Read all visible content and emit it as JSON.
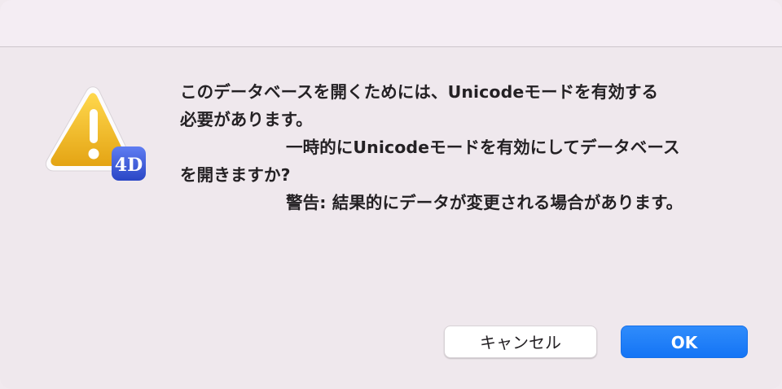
{
  "dialog": {
    "message_lines": [
      "このデータベースを開くためには、Unicodeモードを有効する",
      "必要があります。",
      "一時的にUnicodeモードを有効にしてデータベース",
      "を開きますか?",
      "警告: 結果的にデータが変更される場合があります。"
    ],
    "icon": "warning-triangle-icon",
    "badge_icon": "4d-app-badge-icon",
    "badge_text": "4D"
  },
  "buttons": {
    "cancel_label": "キャンセル",
    "ok_label": "OK"
  },
  "colors": {
    "accent": "#1474f5",
    "warning": "#f0b51e",
    "background": "#efe8ed"
  }
}
